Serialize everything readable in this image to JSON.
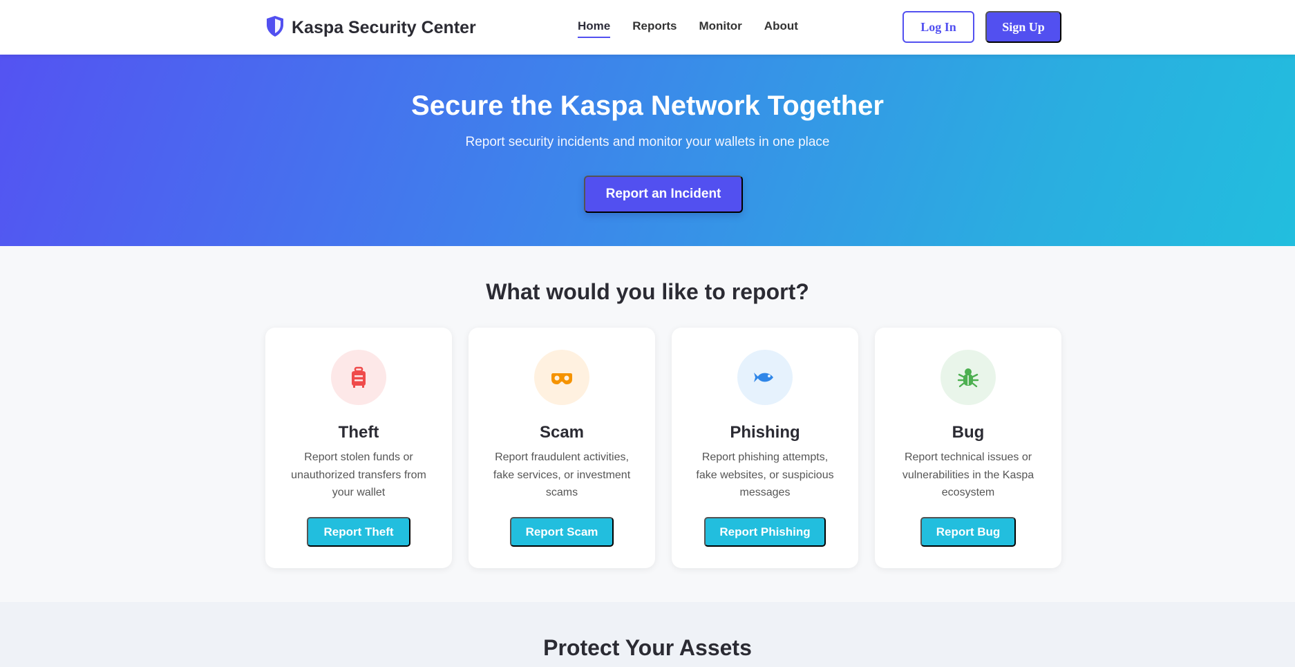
{
  "brand": {
    "title": "Kaspa Security Center",
    "icon": "shield-icon"
  },
  "nav": {
    "links": [
      {
        "label": "Home",
        "active": true
      },
      {
        "label": "Reports",
        "active": false
      },
      {
        "label": "Monitor",
        "active": false
      },
      {
        "label": "About",
        "active": false
      }
    ]
  },
  "auth": {
    "login_label": "Log In",
    "signup_label": "Sign Up"
  },
  "hero": {
    "title": "Secure the Kaspa Network Together",
    "subtitle": "Report security incidents and monitor your wallets in one place",
    "cta_label": "Report an Incident"
  },
  "report_section": {
    "title": "What would you like to report?",
    "cards": [
      {
        "title": "Theft",
        "description": "Report stolen funds or unauthorized transfers from your wallet",
        "button_label": "Report Theft",
        "icon": "suitcase-icon",
        "icon_color": "#ef4b4b",
        "icon_bg": "#fde8e8"
      },
      {
        "title": "Scam",
        "description": "Report fraudulent activities, fake services, or investment scams",
        "button_label": "Report Scam",
        "icon": "mask-icon",
        "icon_color": "#f59300",
        "icon_bg": "#fff1e0"
      },
      {
        "title": "Phishing",
        "description": "Report phishing attempts, fake websites, or suspicious messages",
        "button_label": "Report Phishing",
        "icon": "fish-icon",
        "icon_color": "#2f86e8",
        "icon_bg": "#e6f2fd"
      },
      {
        "title": "Bug",
        "description": "Report technical issues or vulnerabilities in the Kaspa ecosystem",
        "button_label": "Report Bug",
        "icon": "bug-icon",
        "icon_color": "#4caf50",
        "icon_bg": "#e9f5ea"
      }
    ]
  },
  "protect_section": {
    "title": "Protect Your Assets"
  },
  "colors": {
    "primary": "#5250f0",
    "accent": "#22bede"
  }
}
